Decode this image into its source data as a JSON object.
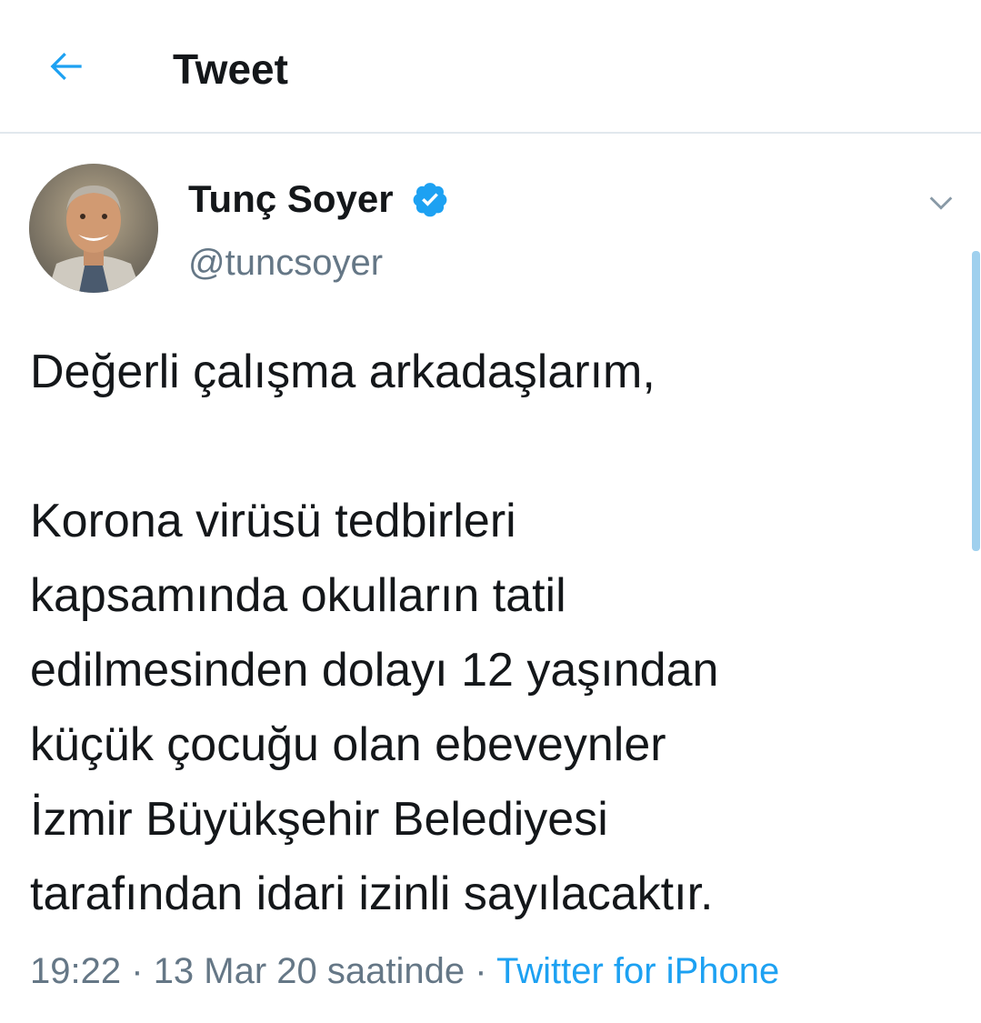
{
  "header": {
    "title": "Tweet",
    "back_icon": "arrow-left-icon"
  },
  "tweet": {
    "author": {
      "name": "Tunç Soyer",
      "handle": "@tuncsoyer",
      "verified_icon": "verified-badge-icon"
    },
    "text_lines": [
      "Değerli çalışma arkadaşlarım,",
      "",
      "Korona virüsü tedbirleri",
      "kapsamında okulların tatil",
      "edilmesinden dolayı 12 yaşından",
      "küçük çocuğu olan ebeveynler",
      "İzmir Büyükşehir Belediyesi",
      "tarafından idari izinli sayılacaktır."
    ],
    "time": "19:22",
    "separator": "·",
    "date": "13 Mar 20 saatinde",
    "source": "Twitter for iPhone"
  },
  "colors": {
    "accent": "#1da1f2",
    "text": "#14171a",
    "secondary": "#657786",
    "divider": "#e1e8ed"
  }
}
